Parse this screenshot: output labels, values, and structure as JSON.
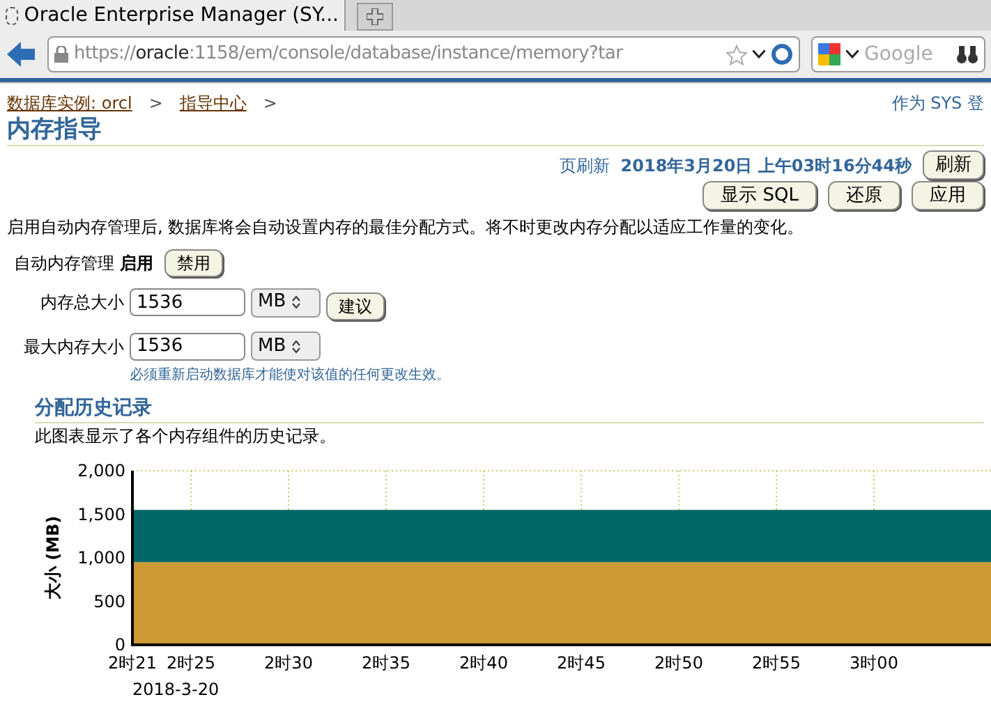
{
  "browser": {
    "tab_title": "Oracle Enterprise Manager (SY...",
    "url_prefix": "https://",
    "url_host": "oracle",
    "url_rest": ":1158/em/console/database/instance/memory?tar",
    "search_placeholder": "Google"
  },
  "breadcrumb": [
    {
      "label": "数据库实例: orcl"
    },
    {
      "label": "指导中心"
    }
  ],
  "separator": ">",
  "login_text": "作为 SYS 登",
  "page_title": "内存指导",
  "refresh": {
    "label": "页刷新",
    "time": "2018年3月20日 上午03时16分44秒",
    "button": "刷新"
  },
  "buttons": [
    {
      "label": "显示 SQL"
    },
    {
      "label": "还原"
    },
    {
      "label": "应用"
    }
  ],
  "description": "启用自动内存管理后, 数据库将会自动设置内存的最佳分配方式。将不时更改内存分配以适应工作量的变化。",
  "auto_memory": {
    "label": "自动内存管理",
    "status": "启用",
    "button": "禁用"
  },
  "fields": [
    {
      "label": "内存总大小",
      "value": "1536",
      "unit": "MB",
      "button": "建议"
    },
    {
      "label": "最大内存大小",
      "value": "1536",
      "unit": "MB"
    }
  ],
  "note": "必须重新启动数据库才能使对该值的任何更改生效。",
  "history": {
    "title": "分配历史记录",
    "description": "此图表显示了各个内存组件的历史记录。",
    "date": "2018-3-20",
    "chart_data": {
      "type": "area",
      "stacked": true,
      "grid": true,
      "ylabel": "大小 (MB)",
      "categories": [
        "2时21",
        "2时25",
        "2时30",
        "2时35",
        "2时40",
        "2时45",
        "2时50",
        "2时55",
        "3时00"
      ],
      "yticks": [
        {
          "value": 0,
          "label": "0"
        },
        {
          "value": 500,
          "label": "500"
        },
        {
          "value": 1000,
          "label": "1,000"
        },
        {
          "value": 1500,
          "label": "1,500"
        },
        {
          "value": 2000,
          "label": "2,000"
        }
      ],
      "ylim": [
        0,
        2000
      ],
      "series": [
        {
          "color": "#cc9933",
          "values": [
            950,
            950,
            950,
            950,
            950,
            950,
            950,
            950,
            950
          ]
        },
        {
          "color": "#006666",
          "values": [
            600,
            600,
            600,
            600,
            600,
            600,
            600,
            600,
            600
          ]
        }
      ]
    }
  }
}
